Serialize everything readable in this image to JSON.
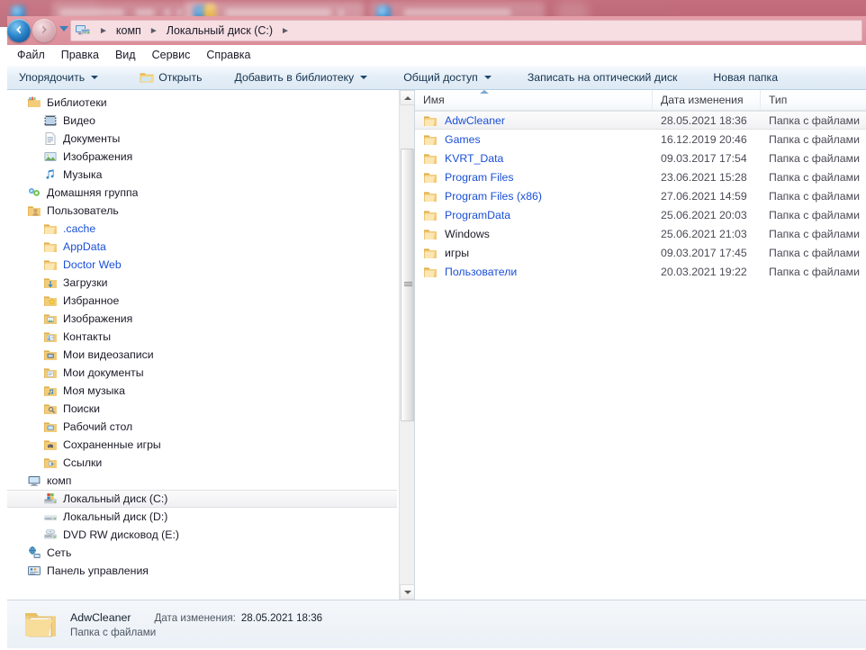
{
  "taskbar": {
    "obscured": true,
    "note": "blurred pink taskbar strip",
    "tint": "#c06b7a"
  },
  "address_bar": {
    "back_button_label": "Назад",
    "forward_button_label": "Вперёд",
    "recent_dropdown_label": "Последние страницы",
    "computer_icon": "computer-drive-icon",
    "breadcrumbs": [
      "комп",
      "Локальный диск (C:)"
    ],
    "separator": "►"
  },
  "menubar": {
    "items": [
      "Файл",
      "Правка",
      "Вид",
      "Сервис",
      "Справка"
    ]
  },
  "toolbar": {
    "items": [
      {
        "label": "Упорядочить",
        "icon": "",
        "caret": true
      },
      {
        "label": "Открыть",
        "icon": "open-folder-icon",
        "caret": false
      },
      {
        "label": "Добавить в библиотеку",
        "icon": "",
        "caret": true
      },
      {
        "label": "Общий доступ",
        "icon": "",
        "caret": true
      },
      {
        "label": "Записать на оптический диск",
        "icon": "",
        "caret": false
      },
      {
        "label": "Новая папка",
        "icon": "",
        "caret": false
      }
    ]
  },
  "navigation_pane": {
    "items": [
      {
        "label": "Библиотеки",
        "icon": "libraries-icon",
        "level": 1,
        "selected": false,
        "blue": false
      },
      {
        "label": "Видео",
        "icon": "video-icon",
        "level": 2,
        "selected": false,
        "blue": false
      },
      {
        "label": "Документы",
        "icon": "documents-icon",
        "level": 2,
        "selected": false,
        "blue": false
      },
      {
        "label": "Изображения",
        "icon": "pictures-icon",
        "level": 2,
        "selected": false,
        "blue": false
      },
      {
        "label": "Музыка",
        "icon": "music-icon",
        "level": 2,
        "selected": false,
        "blue": false
      },
      {
        "label": "Домашняя группа",
        "icon": "homegroup-icon",
        "level": 1,
        "selected": false,
        "blue": false
      },
      {
        "label": "Пользователь",
        "icon": "user-folder-icon",
        "level": 1,
        "selected": false,
        "blue": false
      },
      {
        "label": ".cache",
        "icon": "folder-icon",
        "level": 2,
        "selected": false,
        "blue": true
      },
      {
        "label": "AppData",
        "icon": "folder-icon",
        "level": 2,
        "selected": false,
        "blue": true
      },
      {
        "label": "Doctor Web",
        "icon": "folder-icon",
        "level": 2,
        "selected": false,
        "blue": true
      },
      {
        "label": "Загрузки",
        "icon": "downloads-icon",
        "level": 2,
        "selected": false,
        "blue": false
      },
      {
        "label": "Избранное",
        "icon": "favorites-icon",
        "level": 2,
        "selected": false,
        "blue": false
      },
      {
        "label": "Изображения",
        "icon": "pictures-folder-icon",
        "level": 2,
        "selected": false,
        "blue": false
      },
      {
        "label": "Контакты",
        "icon": "contacts-icon",
        "level": 2,
        "selected": false,
        "blue": false
      },
      {
        "label": "Мои видеозаписи",
        "icon": "my-videos-icon",
        "level": 2,
        "selected": false,
        "blue": false
      },
      {
        "label": "Мои документы",
        "icon": "my-documents-icon",
        "level": 2,
        "selected": false,
        "blue": false
      },
      {
        "label": "Моя музыка",
        "icon": "my-music-icon",
        "level": 2,
        "selected": false,
        "blue": false
      },
      {
        "label": "Поиски",
        "icon": "searches-icon",
        "level": 2,
        "selected": false,
        "blue": false
      },
      {
        "label": "Рабочий стол",
        "icon": "desktop-icon",
        "level": 2,
        "selected": false,
        "blue": false
      },
      {
        "label": "Сохраненные игры",
        "icon": "saved-games-icon",
        "level": 2,
        "selected": false,
        "blue": false
      },
      {
        "label": "Ссылки",
        "icon": "links-icon",
        "level": 2,
        "selected": false,
        "blue": false
      },
      {
        "label": "комп",
        "icon": "computer-icon",
        "level": 1,
        "selected": false,
        "blue": false
      },
      {
        "label": "Локальный диск (C:)",
        "icon": "system-drive-icon",
        "level": 2,
        "selected": true,
        "blue": false
      },
      {
        "label": "Локальный диск (D:)",
        "icon": "drive-icon",
        "level": 2,
        "selected": false,
        "blue": false
      },
      {
        "label": "DVD RW дисковод (E:)",
        "icon": "dvd-drive-icon",
        "level": 2,
        "selected": false,
        "blue": false
      },
      {
        "label": "Сеть",
        "icon": "network-icon",
        "level": 1,
        "selected": false,
        "blue": false
      },
      {
        "label": "Панель управления",
        "icon": "control-panel-icon",
        "level": 1,
        "selected": false,
        "blue": false
      }
    ],
    "scrollbar": {
      "thumb_top_pct": 9,
      "thumb_height_pct": 57
    }
  },
  "file_list": {
    "columns": [
      "Имя",
      "Дата изменения",
      "Тип"
    ],
    "sort_column": "Имя",
    "sort_direction": "ascending",
    "rows": [
      {
        "name": "AdwCleaner",
        "date": "28.05.2021 18:36",
        "type": "Папка с файлами",
        "selected": true,
        "blue": true
      },
      {
        "name": "Games",
        "date": "16.12.2019 20:46",
        "type": "Папка с файлами",
        "selected": false,
        "blue": true
      },
      {
        "name": "KVRT_Data",
        "date": "09.03.2017 17:54",
        "type": "Папка с файлами",
        "selected": false,
        "blue": true
      },
      {
        "name": "Program Files",
        "date": "23.06.2021 15:28",
        "type": "Папка с файлами",
        "selected": false,
        "blue": true
      },
      {
        "name": "Program Files (x86)",
        "date": "27.06.2021 14:59",
        "type": "Папка с файлами",
        "selected": false,
        "blue": true
      },
      {
        "name": "ProgramData",
        "date": "25.06.2021 20:03",
        "type": "Папка с файлами",
        "selected": false,
        "blue": true
      },
      {
        "name": "Windows",
        "date": "25.06.2021 21:03",
        "type": "Папка с файлами",
        "selected": false,
        "blue": false
      },
      {
        "name": "игры",
        "date": "09.03.2017 17:45",
        "type": "Папка с файлами",
        "selected": false,
        "blue": false
      },
      {
        "name": "Пользователи",
        "date": "20.03.2021 19:22",
        "type": "Папка с файлами",
        "selected": false,
        "blue": true
      }
    ]
  },
  "details_pane": {
    "icon": "folder-large-icon",
    "name": "AdwCleaner",
    "date_label": "Дата изменения:",
    "date_value": "28.05.2021 18:36",
    "kind": "Папка с файлами"
  },
  "colors": {
    "compressed_name": "#1a4fd6",
    "plain_name": "#1b1b28",
    "taskbar_tint": "#c06b7a",
    "address_bar": "#e2969f",
    "folder_yellow": "#fcd88a"
  }
}
